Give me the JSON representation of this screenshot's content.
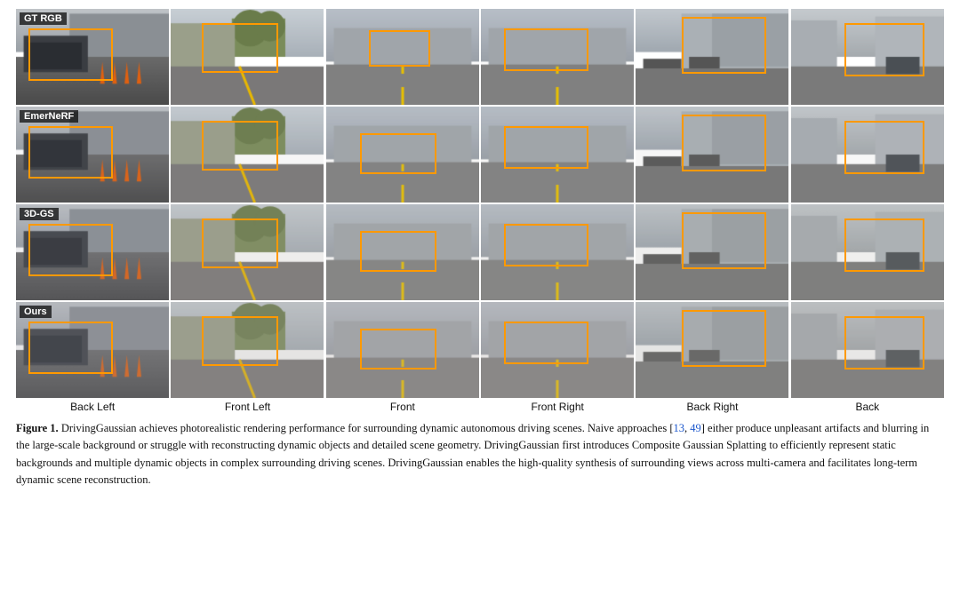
{
  "rows": [
    {
      "label": "GT RGB",
      "id": "gt"
    },
    {
      "label": "EmerNeRF",
      "id": "emernerf"
    },
    {
      "label": "3D-GS",
      "id": "3dgs"
    },
    {
      "label": "Ours",
      "id": "ours"
    }
  ],
  "columns": [
    {
      "label": "Back Left",
      "id": "back-left"
    },
    {
      "label": "Front Left",
      "id": "front-left"
    },
    {
      "label": "Front",
      "id": "front"
    },
    {
      "label": "Front Right",
      "id": "front-right"
    },
    {
      "label": "Back Right",
      "id": "back-right"
    },
    {
      "label": "Back",
      "id": "back"
    }
  ],
  "caption": {
    "figure_num": "Figure 1.",
    "text": "DrivingGaussian achieves photorealistic rendering performance for surrounding dynamic autonomous driving scenes. Naive approaches [13, 49] either produce unpleasant artifacts and blurring in the large-scale background or struggle with reconstructing dynamic objects and detailed scene geometry. DrivingGaussian first introduces Composite Gaussian Splatting to efficiently represent static backgrounds and multiple dynamic objects in complex surrounding driving scenes. DrivingGaussian enables the high-quality synthesis of surrounding views across multi-camera and facilitates long-term dynamic scene reconstruction.",
    "refs": [
      "13",
      "49"
    ]
  },
  "colors": {
    "orange_box": "#f90",
    "label_bg": "rgba(0,0,0,0.72)",
    "label_text": "#ffffff",
    "ref_color": "#1a56cc"
  }
}
